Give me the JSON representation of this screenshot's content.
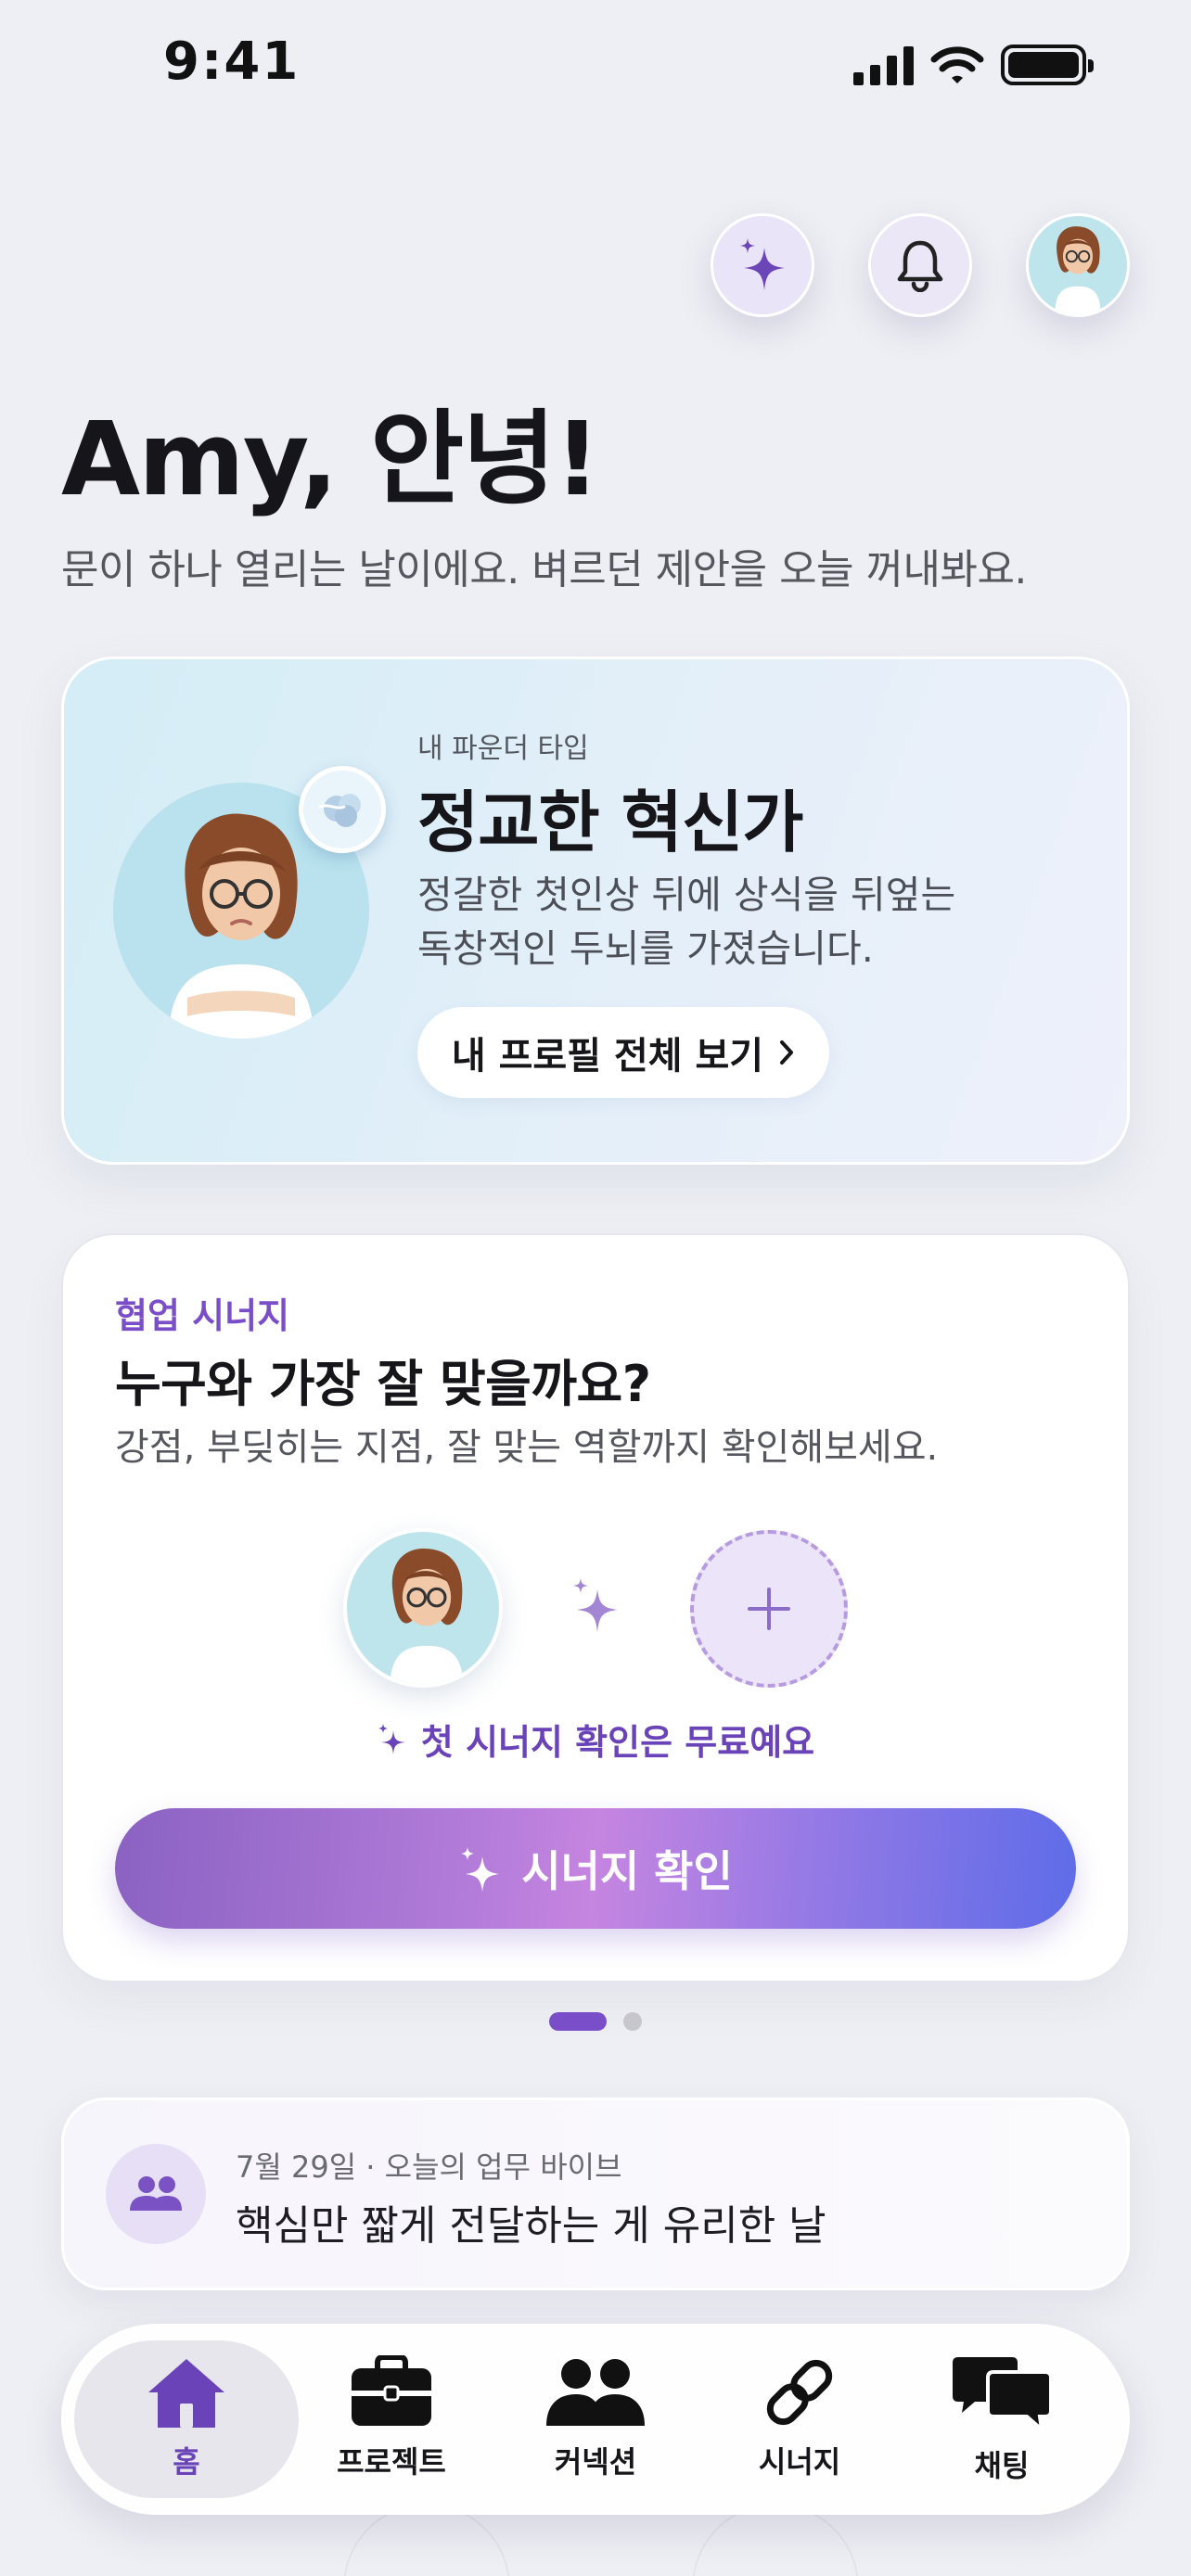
{
  "status_bar": {
    "time": "9:41"
  },
  "header": {
    "greeting": "Amy, 안녕!",
    "subtitle": "문이 하나 열리는 날이에요. 벼르던 제안을 오늘 꺼내봐요."
  },
  "profile_card": {
    "label": "내 파운더 타입",
    "type_name": "정교한 혁신가",
    "description_line1": "정갈한 첫인상 뒤에 상식을 뒤엎는",
    "description_line2": "독창적인 두뇌를 가졌습니다.",
    "button_label": "내 프로필 전체 보기"
  },
  "synergy_card": {
    "tag": "협업 시너지",
    "title": "누구와 가장 잘 맞을까요?",
    "description": "강점, 부딪히는 지점, 잘 맞는 역할까지 확인해보세요.",
    "note": "첫 시너지 확인은 무료예요",
    "button_label": "시너지 확인"
  },
  "pager": {
    "total": 2,
    "active": 1
  },
  "vibe_card": {
    "date": "7월 29일 · 오늘의 업무 바이브",
    "text": "핵심만 짧게 전달하는 게 유리한 날"
  },
  "tabs": [
    {
      "label": "홈",
      "icon": "home-icon",
      "active": true
    },
    {
      "label": "프로젝트",
      "icon": "briefcase-icon",
      "active": false
    },
    {
      "label": "커넥션",
      "icon": "people-icon",
      "active": false
    },
    {
      "label": "시너지",
      "icon": "link-icon",
      "active": false
    },
    {
      "label": "채팅",
      "icon": "chat-icon",
      "active": false
    }
  ],
  "colors": {
    "accent": "#7a4ec8",
    "background": "#eeeff4",
    "profile_card_bg": "#d3edf6",
    "button_gradient_start": "#8a62c2",
    "button_gradient_end": "#5e6ce8"
  }
}
